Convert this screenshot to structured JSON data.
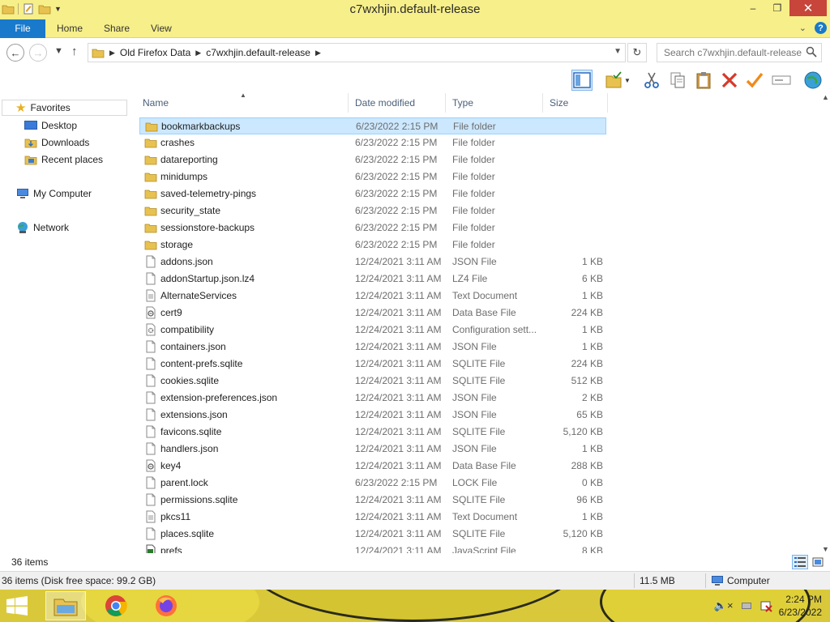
{
  "window": {
    "title": "c7wxhjin.default-release",
    "minimize_glyph": "–",
    "restore_glyph": "❐",
    "close_glyph": "✕"
  },
  "ribbon": {
    "tabs": [
      "File",
      "Home",
      "Share",
      "View"
    ],
    "help": "?"
  },
  "address": {
    "crumbs": [
      "Old Firefox Data",
      "c7wxhjin.default-release"
    ],
    "search_placeholder": "Search c7wxhjin.default-release"
  },
  "navpane": {
    "favorites": "Favorites",
    "desktop": "Desktop",
    "downloads": "Downloads",
    "recent": "Recent places",
    "computer": "My Computer",
    "network": "Network"
  },
  "columns": {
    "name": "Name",
    "date": "Date modified",
    "type": "Type",
    "size": "Size"
  },
  "files": [
    {
      "name": "bookmarkbackups",
      "date": "6/23/2022 2:15 PM",
      "type": "File folder",
      "size": "",
      "icon": "folder-icon"
    },
    {
      "name": "crashes",
      "date": "6/23/2022 2:15 PM",
      "type": "File folder",
      "size": "",
      "icon": "folder-icon"
    },
    {
      "name": "datareporting",
      "date": "6/23/2022 2:15 PM",
      "type": "File folder",
      "size": "",
      "icon": "folder-icon"
    },
    {
      "name": "minidumps",
      "date": "6/23/2022 2:15 PM",
      "type": "File folder",
      "size": "",
      "icon": "folder-icon"
    },
    {
      "name": "saved-telemetry-pings",
      "date": "6/23/2022 2:15 PM",
      "type": "File folder",
      "size": "",
      "icon": "folder-icon"
    },
    {
      "name": "security_state",
      "date": "6/23/2022 2:15 PM",
      "type": "File folder",
      "size": "",
      "icon": "folder-icon"
    },
    {
      "name": "sessionstore-backups",
      "date": "6/23/2022 2:15 PM",
      "type": "File folder",
      "size": "",
      "icon": "folder-icon"
    },
    {
      "name": "storage",
      "date": "6/23/2022 2:15 PM",
      "type": "File folder",
      "size": "",
      "icon": "folder-icon"
    },
    {
      "name": "addons.json",
      "date": "12/24/2021 3:11 AM",
      "type": "JSON File",
      "size": "1 KB",
      "icon": "file-icon"
    },
    {
      "name": "addonStartup.json.lz4",
      "date": "12/24/2021 3:11 AM",
      "type": "LZ4 File",
      "size": "6 KB",
      "icon": "file-icon"
    },
    {
      "name": "AlternateServices",
      "date": "12/24/2021 3:11 AM",
      "type": "Text Document",
      "size": "1 KB",
      "icon": "text-file-icon"
    },
    {
      "name": "cert9",
      "date": "12/24/2021 3:11 AM",
      "type": "Data Base File",
      "size": "224 KB",
      "icon": "database-file-icon"
    },
    {
      "name": "compatibility",
      "date": "12/24/2021 3:11 AM",
      "type": "Configuration sett...",
      "size": "1 KB",
      "icon": "config-file-icon"
    },
    {
      "name": "containers.json",
      "date": "12/24/2021 3:11 AM",
      "type": "JSON File",
      "size": "1 KB",
      "icon": "file-icon"
    },
    {
      "name": "content-prefs.sqlite",
      "date": "12/24/2021 3:11 AM",
      "type": "SQLITE File",
      "size": "224 KB",
      "icon": "file-icon"
    },
    {
      "name": "cookies.sqlite",
      "date": "12/24/2021 3:11 AM",
      "type": "SQLITE File",
      "size": "512 KB",
      "icon": "file-icon"
    },
    {
      "name": "extension-preferences.json",
      "date": "12/24/2021 3:11 AM",
      "type": "JSON File",
      "size": "2 KB",
      "icon": "file-icon"
    },
    {
      "name": "extensions.json",
      "date": "12/24/2021 3:11 AM",
      "type": "JSON File",
      "size": "65 KB",
      "icon": "file-icon"
    },
    {
      "name": "favicons.sqlite",
      "date": "12/24/2021 3:11 AM",
      "type": "SQLITE File",
      "size": "5,120 KB",
      "icon": "file-icon"
    },
    {
      "name": "handlers.json",
      "date": "12/24/2021 3:11 AM",
      "type": "JSON File",
      "size": "1 KB",
      "icon": "file-icon"
    },
    {
      "name": "key4",
      "date": "12/24/2021 3:11 AM",
      "type": "Data Base File",
      "size": "288 KB",
      "icon": "database-file-icon"
    },
    {
      "name": "parent.lock",
      "date": "6/23/2022 2:15 PM",
      "type": "LOCK File",
      "size": "0 KB",
      "icon": "file-icon"
    },
    {
      "name": "permissions.sqlite",
      "date": "12/24/2021 3:11 AM",
      "type": "SQLITE File",
      "size": "96 KB",
      "icon": "file-icon"
    },
    {
      "name": "pkcs11",
      "date": "12/24/2021 3:11 AM",
      "type": "Text Document",
      "size": "1 KB",
      "icon": "text-file-icon"
    },
    {
      "name": "places.sqlite",
      "date": "12/24/2021 3:11 AM",
      "type": "SQLITE File",
      "size": "5,120 KB",
      "icon": "file-icon"
    },
    {
      "name": "prefs",
      "date": "12/24/2021 3:11 AM",
      "type": "JavaScript File",
      "size": "8 KB",
      "icon": "script-file-icon"
    }
  ],
  "selected_index": 0,
  "item_count": "36 items",
  "status": {
    "left": "36 items (Disk free space: 99.2 GB)",
    "size": "11.5 MB",
    "location": "Computer"
  },
  "taskbar": {
    "time": "2:24 PM",
    "date": "6/23/2022"
  },
  "colors": {
    "titlebar": "#f7ef8a",
    "file_tab": "#1979ca",
    "selection": "#cce8ff",
    "taskbar": "#d9c93a"
  }
}
